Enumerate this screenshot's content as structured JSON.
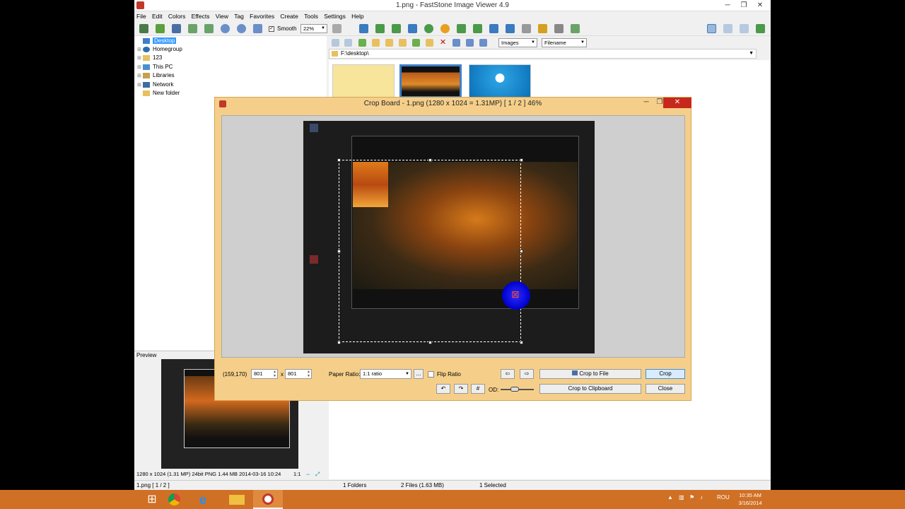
{
  "window": {
    "title": "1.png  -  FastStone Image Viewer 4.9",
    "min": "─",
    "max": "❐",
    "close": "✕"
  },
  "menu": [
    "File",
    "Edit",
    "Colors",
    "Effects",
    "View",
    "Tag",
    "Favorites",
    "Create",
    "Tools",
    "Settings",
    "Help"
  ],
  "toolbar": {
    "smooth_label": "Smooth",
    "smooth_checked": "✓",
    "zoom_value": "22%"
  },
  "nav": {
    "images_filter": "Images",
    "sort_by": "Filename",
    "path": "F:\\desktop\\"
  },
  "tree": [
    {
      "label": "Desktop",
      "icon": "desktop-icon"
    },
    {
      "label": "Homegroup",
      "icon": "homegroup-icon"
    },
    {
      "label": "123",
      "icon": "folder-icon"
    },
    {
      "label": "This PC",
      "icon": "computer-icon"
    },
    {
      "label": "Libraries",
      "icon": "libraries-icon"
    },
    {
      "label": "Network",
      "icon": "network-icon"
    },
    {
      "label": "New folder",
      "icon": "folder-icon"
    }
  ],
  "preview": {
    "header": "Preview",
    "info": "1280 x 1024 (1.31 MP)  24bit  PNG   1.44 MB   2014-03-16 10:24",
    "ratio": "1:1"
  },
  "status": {
    "file": "1.png [ 1 / 2 ]",
    "folders": "1 Folders",
    "files": "2 Files (1.63 MB)",
    "selected": "1 Selected"
  },
  "crop": {
    "title": "Crop Board  -  1.png  (1280 x 1024 = 1.31MP)  [ 1 / 2 ]   46%",
    "coords": "(159,170)",
    "width": "801",
    "times": "x",
    "height": "801",
    "paper_ratio_label": "Paper Ratio:",
    "paper_ratio_value": "1:1 ratio",
    "more_button": "...",
    "flip_ratio_label": "Flip Ratio",
    "od_label": "OD:",
    "crop_to_file": "Crop to File",
    "crop": "Crop",
    "crop_to_clipboard": "Crop to Clipboard",
    "close": "Close",
    "min": "─",
    "max": "❐",
    "close_x": "✕"
  },
  "taskbar": {
    "tray_lang": "ROU",
    "clock_time": "10:35 AM",
    "clock_date": "3/16/2014"
  },
  "colors": {
    "taskbar": "#d07025",
    "crop_frame": "#f5cf8a",
    "selection": "#3399ff"
  }
}
